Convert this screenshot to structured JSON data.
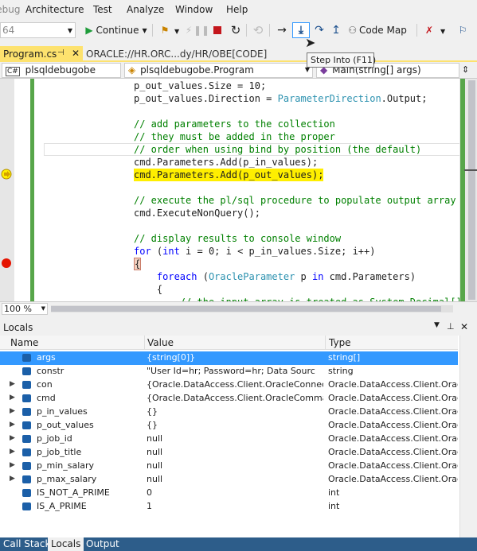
{
  "menu": {
    "items": [
      "Debug",
      "Architecture",
      "Test",
      "Analyze",
      "Window",
      "Help"
    ]
  },
  "toolbar": {
    "platform_value": "64",
    "continue_label": "Continue",
    "code_map_label": "Code Map"
  },
  "tooltip": {
    "text": "Step Into (F11)"
  },
  "tabs": [
    {
      "label": "Program.cs",
      "active": true
    },
    {
      "label": "ORACLE://HR.ORC...dy/HR/OBE[CODE]",
      "active": false
    }
  ],
  "navbar": {
    "project": "plsqldebugobe",
    "class": "plsqldebugobe.Program",
    "member": "Main(string[] args)"
  },
  "editor": {
    "lines": [
      "p_out_values.Size = 10;",
      "p_out_values.Direction = ParameterDirection.Output;",
      "",
      "// add parameters to the collection",
      "// they must be added in the proper",
      "// order when using bind by position (the default)",
      "cmd.Parameters.Add(p_in_values);",
      "cmd.Parameters.Add(p_out_values);",
      "",
      "// execute the pl/sql procedure to populate output array",
      "cmd.ExecuteNonQuery();",
      "",
      "// display results to console window",
      "for (int i = 0; i < p_in_values.Size; i++)",
      "{",
      "    foreach (OracleParameter p in cmd.Parameters)",
      "    {",
      "        // the input array is treated as System.Decimal[]"
    ],
    "zoom": "100 %"
  },
  "locals": {
    "title": "Locals",
    "columns": [
      "Name",
      "Value",
      "Type"
    ],
    "rows": [
      {
        "name": "args",
        "value": "{string[0]}",
        "type": "string[]",
        "expandable": false,
        "selected": true
      },
      {
        "name": "constr",
        "value": "\"User Id=hr; Password=hr; Data Sourc",
        "type": "string",
        "expandable": false,
        "selected": false
      },
      {
        "name": "con",
        "value": "{Oracle.DataAccess.Client.OracleConnectio",
        "type": "Oracle.DataAccess.Client.Oracl",
        "expandable": true,
        "selected": false
      },
      {
        "name": "cmd",
        "value": "{Oracle.DataAccess.Client.OracleComman",
        "type": "Oracle.DataAccess.Client.Oracl",
        "expandable": true,
        "selected": false
      },
      {
        "name": "p_in_values",
        "value": "{}",
        "type": "Oracle.DataAccess.Client.Oracl",
        "expandable": true,
        "selected": false
      },
      {
        "name": "p_out_values",
        "value": "{}",
        "type": "Oracle.DataAccess.Client.Oracl",
        "expandable": true,
        "selected": false
      },
      {
        "name": "p_job_id",
        "value": "null",
        "type": "Oracle.DataAccess.Client.Oracl",
        "expandable": true,
        "selected": false
      },
      {
        "name": "p_job_title",
        "value": "null",
        "type": "Oracle.DataAccess.Client.Oracl",
        "expandable": true,
        "selected": false
      },
      {
        "name": "p_min_salary",
        "value": "null",
        "type": "Oracle.DataAccess.Client.Oracl",
        "expandable": true,
        "selected": false
      },
      {
        "name": "p_max_salary",
        "value": "null",
        "type": "Oracle.DataAccess.Client.Oracl",
        "expandable": true,
        "selected": false
      },
      {
        "name": "IS_NOT_A_PRIME",
        "value": "0",
        "type": "int",
        "expandable": false,
        "selected": false
      },
      {
        "name": "IS_A_PRIME",
        "value": "1",
        "type": "int",
        "expandable": false,
        "selected": false
      }
    ]
  },
  "bottom_tabs": [
    {
      "label": "Call Stack",
      "active": false
    },
    {
      "label": "Locals",
      "active": true
    },
    {
      "label": "Output",
      "active": false
    }
  ],
  "colors": {
    "accent": "#3399ff",
    "change_bar": "#57a64a",
    "current_statement": "#ffef00",
    "breakpoint": "#e51400",
    "comment": "#008000",
    "keyword": "#0000ff",
    "type": "#2b91af"
  }
}
